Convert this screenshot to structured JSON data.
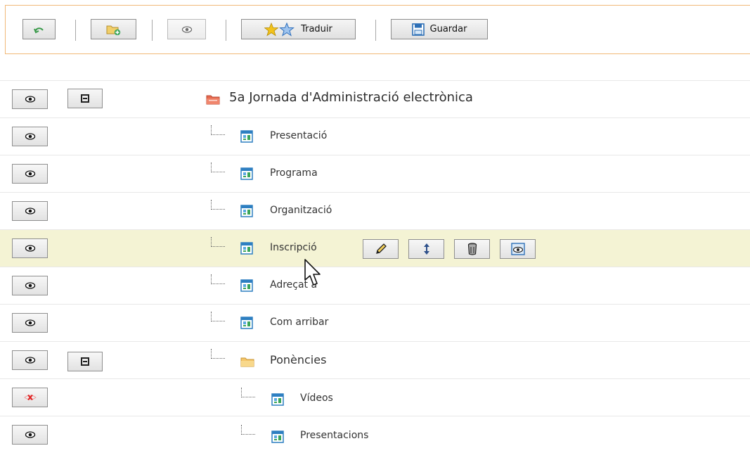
{
  "toolbar": {
    "back_icon": "back-arrow-icon",
    "new_folder_icon": "new-folder-icon",
    "preview_icon": "eye-icon",
    "translate_label": "Traduir",
    "save_label": "Guardar"
  },
  "tree": {
    "root_label": "5a Jornada d'Administració electrònica",
    "items": [
      {
        "label": "Presentació"
      },
      {
        "label": "Programa"
      },
      {
        "label": "Organització"
      },
      {
        "label": "Inscripció"
      },
      {
        "label": "Adreçat a"
      },
      {
        "label": "Com arribar"
      },
      {
        "label": "Ponències"
      },
      {
        "label": "Vídeos"
      },
      {
        "label": "Presentacions"
      }
    ]
  },
  "row_actions": {
    "edit_icon": "pencil-icon",
    "move_icon": "move-updown-icon",
    "delete_icon": "trash-icon",
    "view_icon": "preview-icon"
  },
  "colors": {
    "toolbar_border": "#f1b978",
    "highlight_row": "#f4f3d4",
    "page_icon": "#2d7fc1",
    "root_folder": "#e66a4f",
    "folder": "#f4c56a"
  }
}
